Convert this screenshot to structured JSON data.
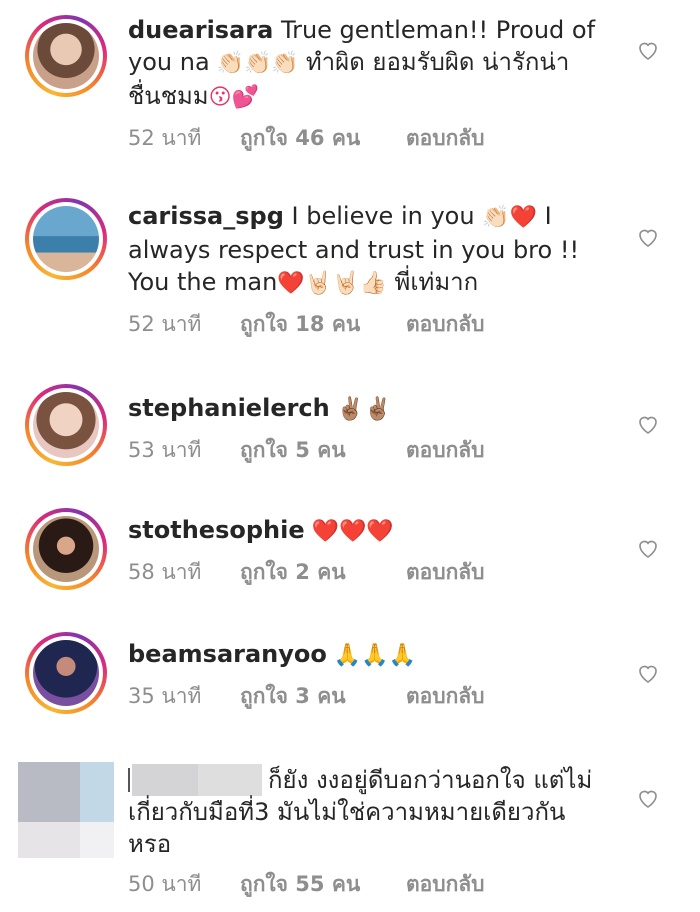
{
  "comments": [
    {
      "username": "duearisara",
      "text": " True gentleman!! Proud of you na",
      "emoji_after": " 👏🏻👏🏻👏🏻 ",
      "text2": "ทำผิด ยอมรับผิด น่ารักน่าชื่นชมม",
      "emoji_end": "😗💕",
      "time": "52 นาที",
      "likes": "ถูกใจ 46 คน",
      "reply": "ตอบกลับ"
    },
    {
      "username": "carissa_spg",
      "text": " I believe in you ",
      "emoji_after": "👏🏻❤️",
      "text2": " I always respect and trust in you bro !! You the man",
      "emoji_end": "❤️🤘🏻🤘🏻👍🏻",
      "text3": " พี่เท่มาก",
      "time": "52 นาที",
      "likes": "ถูกใจ 18 คน",
      "reply": "ตอบกลับ"
    },
    {
      "username": "stephanielerch",
      "emoji_end": " ✌🏽✌🏽",
      "time": "53 นาที",
      "likes": "ถูกใจ 5 คน",
      "reply": "ตอบกลับ"
    },
    {
      "username": "stothesophie",
      "emoji_end": " ❤️❤️❤️",
      "time": "58 นาที",
      "likes": "ถูกใจ 2 คน",
      "reply": "ตอบกลับ"
    },
    {
      "username": "beamsaranyoo",
      "emoji_end": " 🙏🙏🙏",
      "time": "35 นาที",
      "likes": "ถูกใจ 3 คน",
      "reply": "ตอบกลับ"
    },
    {
      "username": "",
      "text": "ก็ยัง งงอยู่ดีบอกว่านอกใจ แต่ไม่เกี่ยวกับมือที่3 มันไม่ใช่ความหมายเดียวกันหรอ",
      "time": "50 นาที",
      "likes": "ถูกใจ 55 คน",
      "reply": "ตอบกลับ"
    }
  ],
  "colors": {
    "text": "#262626",
    "meta": "#8e8e8e",
    "heart_red": "#e0123a"
  }
}
